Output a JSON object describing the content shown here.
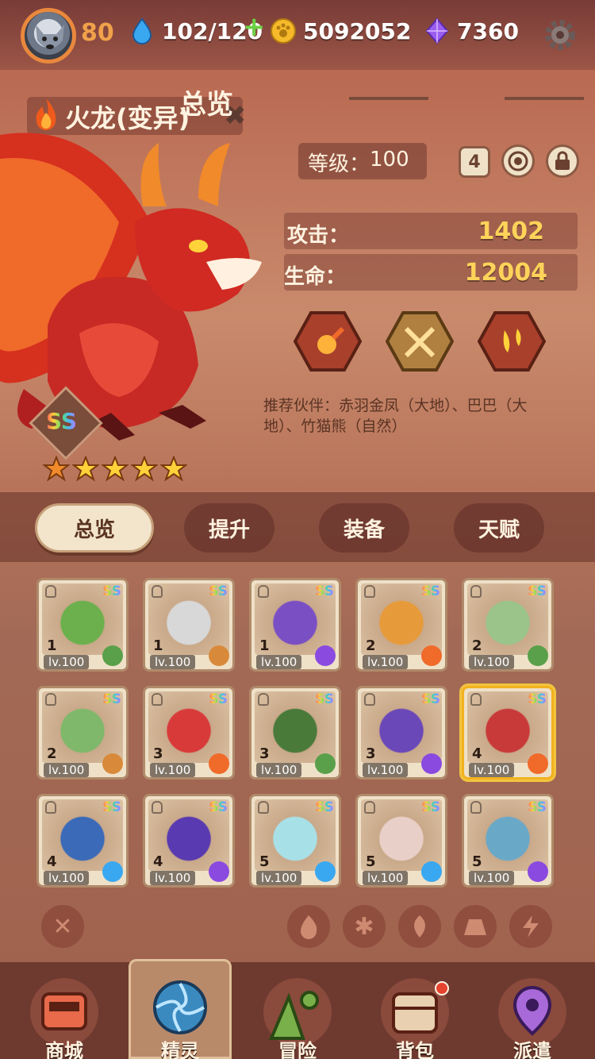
{
  "topbar": {
    "player_level": "80",
    "energy": "102/120",
    "coins": "5092052",
    "gems": "7360"
  },
  "hero": {
    "name": "火龙(变异)",
    "rank": "SS",
    "stars": 5
  },
  "overview": {
    "title": "总览",
    "level_label": "等级：",
    "level_value": "100",
    "level_badge": "4",
    "attack_label": "攻击：",
    "attack_value": "1402",
    "hp_label": "生命：",
    "hp_value": "12004",
    "partner_text": "推荐伙伴：赤羽金凤（大地）、巴巴（大地）、竹猫熊（自然）"
  },
  "tabs": [
    {
      "label": "总览"
    },
    {
      "label": "提升"
    },
    {
      "label": "装备"
    },
    {
      "label": "天赋"
    }
  ],
  "cards": [
    {
      "num": "1",
      "lv": "lv.100",
      "rank": "SS",
      "element": "leaf-icon",
      "color": "#6bb04c"
    },
    {
      "num": "1",
      "lv": "lv.100",
      "rank": "SS",
      "element": "earth-icon",
      "color": "#d8d8d8"
    },
    {
      "num": "1",
      "lv": "lv.100",
      "rank": "SS",
      "element": "lightning-icon",
      "color": "#7a4fc4"
    },
    {
      "num": "2",
      "lv": "lv.100",
      "rank": "SS",
      "element": "fire-icon",
      "color": "#e79a3a"
    },
    {
      "num": "2",
      "lv": "lv.100",
      "rank": "SS",
      "element": "leaf-icon",
      "color": "#9bc48a"
    },
    {
      "num": "2",
      "lv": "lv.100",
      "rank": "SS",
      "element": "earth-icon",
      "color": "#7fb86a"
    },
    {
      "num": "3",
      "lv": "lv.100",
      "rank": "SS",
      "element": "fire-icon",
      "color": "#d83a3a"
    },
    {
      "num": "3",
      "lv": "lv.100",
      "rank": "SS",
      "element": "leaf-icon",
      "color": "#4a7a3a"
    },
    {
      "num": "3",
      "lv": "lv.100",
      "rank": "SS",
      "element": "lightning-icon",
      "color": "#6a48b8"
    },
    {
      "num": "4",
      "lv": "lv.100",
      "rank": "SS",
      "element": "fire-icon",
      "color": "#c83a3a"
    },
    {
      "num": "4",
      "lv": "lv.100",
      "rank": "SS",
      "element": "ice-icon",
      "color": "#3a6ab8"
    },
    {
      "num": "4",
      "lv": "lv.100",
      "rank": "SS",
      "element": "lightning-icon",
      "color": "#5a3ab0"
    },
    {
      "num": "5",
      "lv": "lv.100",
      "rank": "SS",
      "element": "ice-icon",
      "color": "#a8e0e8"
    },
    {
      "num": "5",
      "lv": "lv.100",
      "rank": "SS",
      "element": "ice-icon",
      "color": "#e8d0c8"
    },
    {
      "num": "5",
      "lv": "lv.100",
      "rank": "SS",
      "element": "lightning-icon",
      "color": "#6aa8c8"
    }
  ],
  "nav": [
    {
      "label": "商城",
      "icon": "shop-icon"
    },
    {
      "label": "精灵",
      "icon": "sprite-icon"
    },
    {
      "label": "冒险",
      "icon": "adventure-icon"
    },
    {
      "label": "背包",
      "icon": "bag-icon"
    },
    {
      "label": "派遣",
      "icon": "dispatch-icon"
    }
  ]
}
